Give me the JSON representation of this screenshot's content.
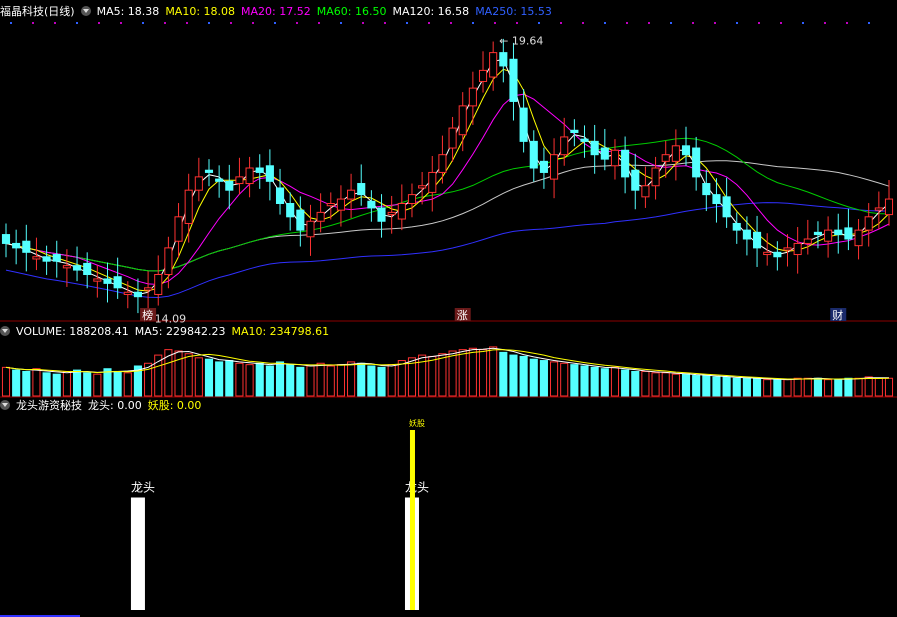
{
  "colors": {
    "up": "#ff3232",
    "down": "#54ffff",
    "ma5": "#ffffff",
    "ma10": "#ffff00",
    "ma20": "#ff00ff",
    "ma60": "#00cc00",
    "ma120": "#c8c8c8",
    "ma250": "#3030ff",
    "signal_white": "#ffffff",
    "signal_yellow": "#ffff00"
  },
  "price_panel": {
    "title": "福晶科技(日线)",
    "ma_labels": [
      {
        "text": "MA5: 18.38",
        "color": "#ffffff"
      },
      {
        "text": "MA10: 18.08",
        "color": "#ffff00"
      },
      {
        "text": "MA20: 17.52",
        "color": "#ff00ff"
      },
      {
        "text": "MA60: 16.50",
        "color": "#00ff00"
      },
      {
        "text": "MA120: 16.58",
        "color": "#ffffff"
      },
      {
        "text": "MA250: 15.53",
        "color": "#3060ff"
      }
    ],
    "high_label": "19.64",
    "low_label": "14.09",
    "event_markers": [
      "榜",
      "涨",
      "财"
    ]
  },
  "volume_panel": {
    "labels": [
      {
        "text": "VOLUME: 188208.41",
        "color": "#ffffff"
      },
      {
        "text": "MA5: 229842.23",
        "color": "#ffffff"
      },
      {
        "text": "MA10: 234798.61",
        "color": "#ffff00"
      }
    ]
  },
  "indicator_panel": {
    "labels": [
      {
        "text": "龙头游资秘技",
        "color": "#ffffff"
      },
      {
        "text": "龙头: 0.00",
        "color": "#ffffff"
      },
      {
        "text": "妖股: 0.00",
        "color": "#ffff00"
      }
    ],
    "bar_label_a": "龙头",
    "bar_label_b": "妖股"
  },
  "chart_data": {
    "type": "candlestick",
    "price_range": [
      13.8,
      20.2
    ],
    "close_series": [
      15.3,
      15.2,
      15.1,
      15.0,
      14.9,
      14.9,
      14.8,
      14.7,
      14.6,
      14.5,
      14.4,
      14.3,
      14.2,
      14.1,
      14.3,
      14.6,
      15.2,
      15.9,
      16.5,
      16.8,
      16.9,
      16.7,
      16.5,
      16.8,
      17.0,
      16.9,
      16.7,
      16.2,
      15.9,
      15.6,
      15.8,
      16.0,
      16.2,
      16.3,
      16.5,
      16.4,
      16.1,
      15.8,
      16.0,
      16.2,
      16.4,
      16.6,
      16.9,
      17.3,
      17.9,
      18.4,
      18.8,
      19.2,
      19.6,
      19.3,
      18.5,
      17.6,
      17.0,
      16.9,
      17.3,
      17.7,
      17.8,
      17.6,
      17.3,
      17.2,
      17.4,
      16.8,
      16.5,
      16.6,
      17.0,
      17.3,
      17.5,
      17.3,
      16.8,
      16.4,
      16.2,
      15.9,
      15.6,
      15.4,
      15.2,
      15.1,
      15.0,
      15.2,
      15.3,
      15.4,
      15.5,
      15.6,
      15.5,
      15.4,
      15.6,
      15.9,
      16.1,
      16.3
    ],
    "volume_series": [
      21,
      19,
      18,
      20,
      17,
      16,
      18,
      19,
      17,
      16,
      20,
      18,
      17,
      22,
      24,
      30,
      34,
      33,
      31,
      28,
      27,
      25,
      26,
      24,
      23,
      24,
      22,
      25,
      23,
      21,
      22,
      24,
      22,
      23,
      25,
      24,
      22,
      21,
      23,
      26,
      28,
      30,
      29,
      31,
      33,
      34,
      35,
      34,
      36,
      32,
      30,
      29,
      27,
      26,
      25,
      24,
      23,
      22,
      21,
      20,
      21,
      19,
      18,
      18,
      17,
      17,
      16,
      16,
      15,
      15,
      14,
      14,
      13,
      13,
      13,
      12,
      12,
      12,
      13,
      13,
      13,
      12,
      12,
      13,
      13,
      14,
      13,
      13
    ],
    "indicator_series": {
      "longtou": [
        {
          "index": 13,
          "value": 1
        },
        {
          "index": 40,
          "value": 1
        }
      ],
      "yaogu": [
        {
          "index": 40,
          "value": 1.6
        }
      ]
    }
  }
}
